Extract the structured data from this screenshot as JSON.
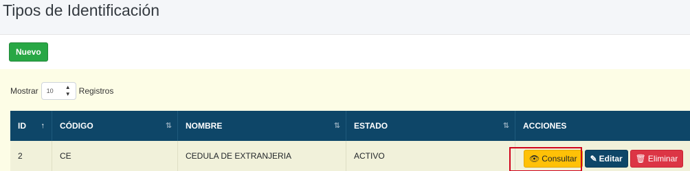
{
  "page": {
    "title": "Tipos de Identificación"
  },
  "toolbar": {
    "new_label": "Nuevo"
  },
  "table_controls": {
    "show_label": "Mostrar",
    "length_value": "10",
    "records_label": "Registros"
  },
  "table": {
    "columns": [
      {
        "label": "ID",
        "sort": "asc"
      },
      {
        "label": "CÓDIGO",
        "sort": "both"
      },
      {
        "label": "NOMBRE",
        "sort": "both"
      },
      {
        "label": "ESTADO",
        "sort": "both"
      },
      {
        "label": "ACCIONES",
        "sort": "none"
      }
    ],
    "rows": [
      {
        "id": "2",
        "code": "CE",
        "name": "CEDULA DE EXTRANJERIA",
        "status": "ACTIVO"
      }
    ],
    "actions": {
      "consult": "Consultar",
      "edit": "Editar",
      "delete": "Eliminar"
    }
  },
  "icons": {
    "sort_asc": "sort-asc-icon",
    "sort_both": "sort-both-icon",
    "consult": "eye-icon",
    "edit": "edit-icon",
    "delete": "trash-icon"
  },
  "colors": {
    "header_bg": "#0e4668",
    "new_button": "#28a745",
    "consult_button": "#ffc107",
    "edit_button": "#0e4668",
    "delete_button": "#dc3545",
    "highlight": "#d0021b"
  }
}
